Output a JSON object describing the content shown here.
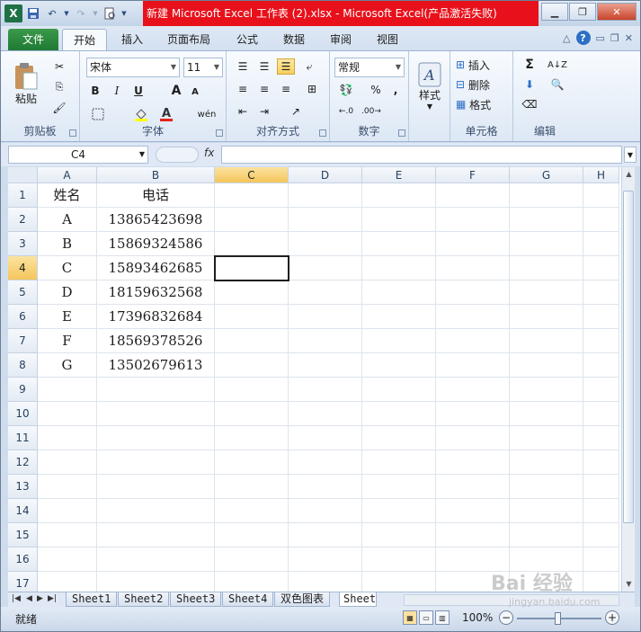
{
  "window": {
    "title": "新建 Microsoft Excel 工作表 (2).xlsx - Microsoft Excel(产品激活失败)"
  },
  "qat": {
    "excel_logo": "X"
  },
  "tabs": [
    {
      "label": "文件"
    },
    {
      "label": "开始"
    },
    {
      "label": "插入"
    },
    {
      "label": "页面布局"
    },
    {
      "label": "公式"
    },
    {
      "label": "数据"
    },
    {
      "label": "审阅"
    },
    {
      "label": "视图"
    }
  ],
  "ribbon": {
    "clipboard": {
      "paste": "粘贴",
      "label": "剪贴板"
    },
    "font": {
      "name": "宋体",
      "size": "11",
      "bold": "B",
      "italic": "I",
      "underline": "U",
      "grow": "A",
      "shrink": "A",
      "color_a": "A",
      "wen": "wén",
      "label": "字体"
    },
    "align": {
      "label": "对齐方式"
    },
    "number": {
      "format": "常规",
      "percent": "%",
      "comma": ",",
      "label": "数字"
    },
    "styles": {
      "label": "样式",
      "button": "样式"
    },
    "cells": {
      "insert": "插入",
      "delete": "删除",
      "format": "格式",
      "label": "单元格"
    },
    "edit": {
      "sum": "Σ",
      "label": "编辑"
    }
  },
  "formula_bar": {
    "name_box": "C4",
    "fx": "fx",
    "content": ""
  },
  "grid": {
    "columns": [
      "A",
      "B",
      "C",
      "D",
      "E",
      "F",
      "G",
      "H"
    ],
    "rows": [
      "1",
      "2",
      "3",
      "4",
      "5",
      "6",
      "7",
      "8",
      "9",
      "10",
      "11",
      "12",
      "13",
      "14",
      "15",
      "16",
      "17"
    ],
    "selected_col": "C",
    "selected_row": "4",
    "cells": [
      [
        "姓名",
        "电话"
      ],
      [
        "A",
        "13865423698"
      ],
      [
        "B",
        "15869324586"
      ],
      [
        "C",
        "15893462685"
      ],
      [
        "D",
        "18159632568"
      ],
      [
        "E",
        "17396832684"
      ],
      [
        "F",
        "18569378526"
      ],
      [
        "G",
        "13502679613"
      ]
    ]
  },
  "sheets": [
    {
      "label": "Sheet1"
    },
    {
      "label": "Sheet2"
    },
    {
      "label": "Sheet3"
    },
    {
      "label": "Sheet4"
    },
    {
      "label": "双色图表"
    },
    {
      "label": "Sheet"
    }
  ],
  "status": {
    "text": "就绪",
    "zoom": "100%",
    "minus": "−",
    "plus": "+"
  },
  "watermark": {
    "main": "Bai 经验",
    "sub": "jingyan.baidu.com"
  }
}
